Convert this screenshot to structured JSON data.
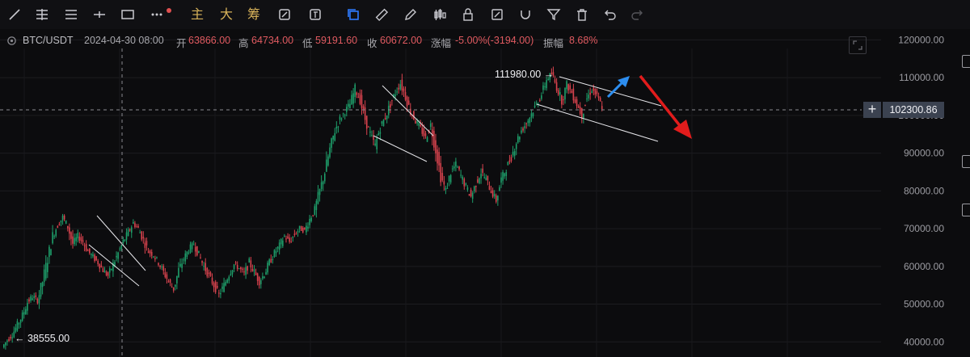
{
  "toolbar": {
    "text_buttons": [
      "主",
      "大",
      "筹"
    ],
    "colors": {
      "icon": "#c9c9cf",
      "active": "#2f7bff",
      "text_button": "#d7b25a",
      "badge": "#e05050"
    }
  },
  "header": {
    "symbol": "BTC/USDT",
    "datetime": "2024-04-30 08:00",
    "open_label": "开",
    "open": "63866.00",
    "high_label": "高",
    "high": "64734.00",
    "low_label": "低",
    "low": "59191.60",
    "close_label": "收",
    "close": "60672.00",
    "change_label": "涨幅",
    "change": "-5.00%(-3194.00)",
    "amplitude_label": "振幅",
    "amplitude": "8.68%"
  },
  "price_axis": {
    "ticks": [
      "120000.00",
      "110000.00",
      "100000.00",
      "90000.00",
      "80000.00",
      "70000.00",
      "60000.00",
      "50000.00",
      "40000.00"
    ],
    "current_price": "102300.86"
  },
  "annotations": {
    "high_marker": "111980.00 →",
    "low_marker": "← 38555.00",
    "up_arrow_color": "#2d8ef0",
    "down_arrow_color": "#e21c1c"
  },
  "chart_data": {
    "type": "candlestick",
    "title": "",
    "xlabel": "",
    "ylabel": "",
    "ylim": [
      36000,
      122000
    ],
    "up_color": "#1e9e6a",
    "down_color": "#d9434e",
    "series": [
      {
        "x": 0,
        "values": [
          38555,
          40500,
          42000,
          44500,
          47000,
          50500,
          52000,
          51000,
          56000,
          62000,
          68000,
          71000,
          73000,
          70500,
          66000
        ]
      },
      {
        "x": 1,
        "values": [
          68000,
          66500,
          64000,
          62500,
          61000,
          59000,
          57500,
          60500,
          63500,
          66500,
          69000,
          71500,
          70000,
          67000,
          64000
        ]
      },
      {
        "x": 2,
        "values": [
          63000,
          61000,
          58500,
          56000,
          54000,
          59000,
          62000,
          64500,
          66000,
          63000,
          60000,
          57500,
          55000,
          52500,
          55000
        ]
      },
      {
        "x": 3,
        "values": [
          58000,
          60500,
          59500,
          58000,
          61000,
          58500,
          56000,
          58000,
          61000,
          63500,
          65500,
          68000,
          66500,
          68500,
          70000
        ]
      },
      {
        "x": 4,
        "values": [
          69500,
          72500,
          75000,
          80000,
          85000,
          91000,
          96000,
          99000,
          101000,
          103000,
          107000,
          104000,
          99000,
          95000,
          92000
        ]
      },
      {
        "x": 5,
        "values": [
          97000,
          99500,
          103000,
          106000,
          108500,
          105000,
          101000,
          98500,
          96500,
          94000,
          97500,
          91000,
          84000,
          80000,
          85000
        ]
      },
      {
        "x": 6,
        "values": [
          87000,
          84000,
          81000,
          78500,
          82000,
          85000,
          83000,
          80000,
          77500,
          83000,
          86000,
          89000,
          93000,
          96000,
          98000
        ]
      },
      {
        "x": 7,
        "values": [
          100500,
          103000,
          105500,
          109500,
          111000,
          107500,
          104000,
          108000,
          106000,
          103000,
          100000,
          104500,
          107000,
          105000,
          102300
        ]
      }
    ],
    "trend_channels": 4,
    "grid": true
  }
}
